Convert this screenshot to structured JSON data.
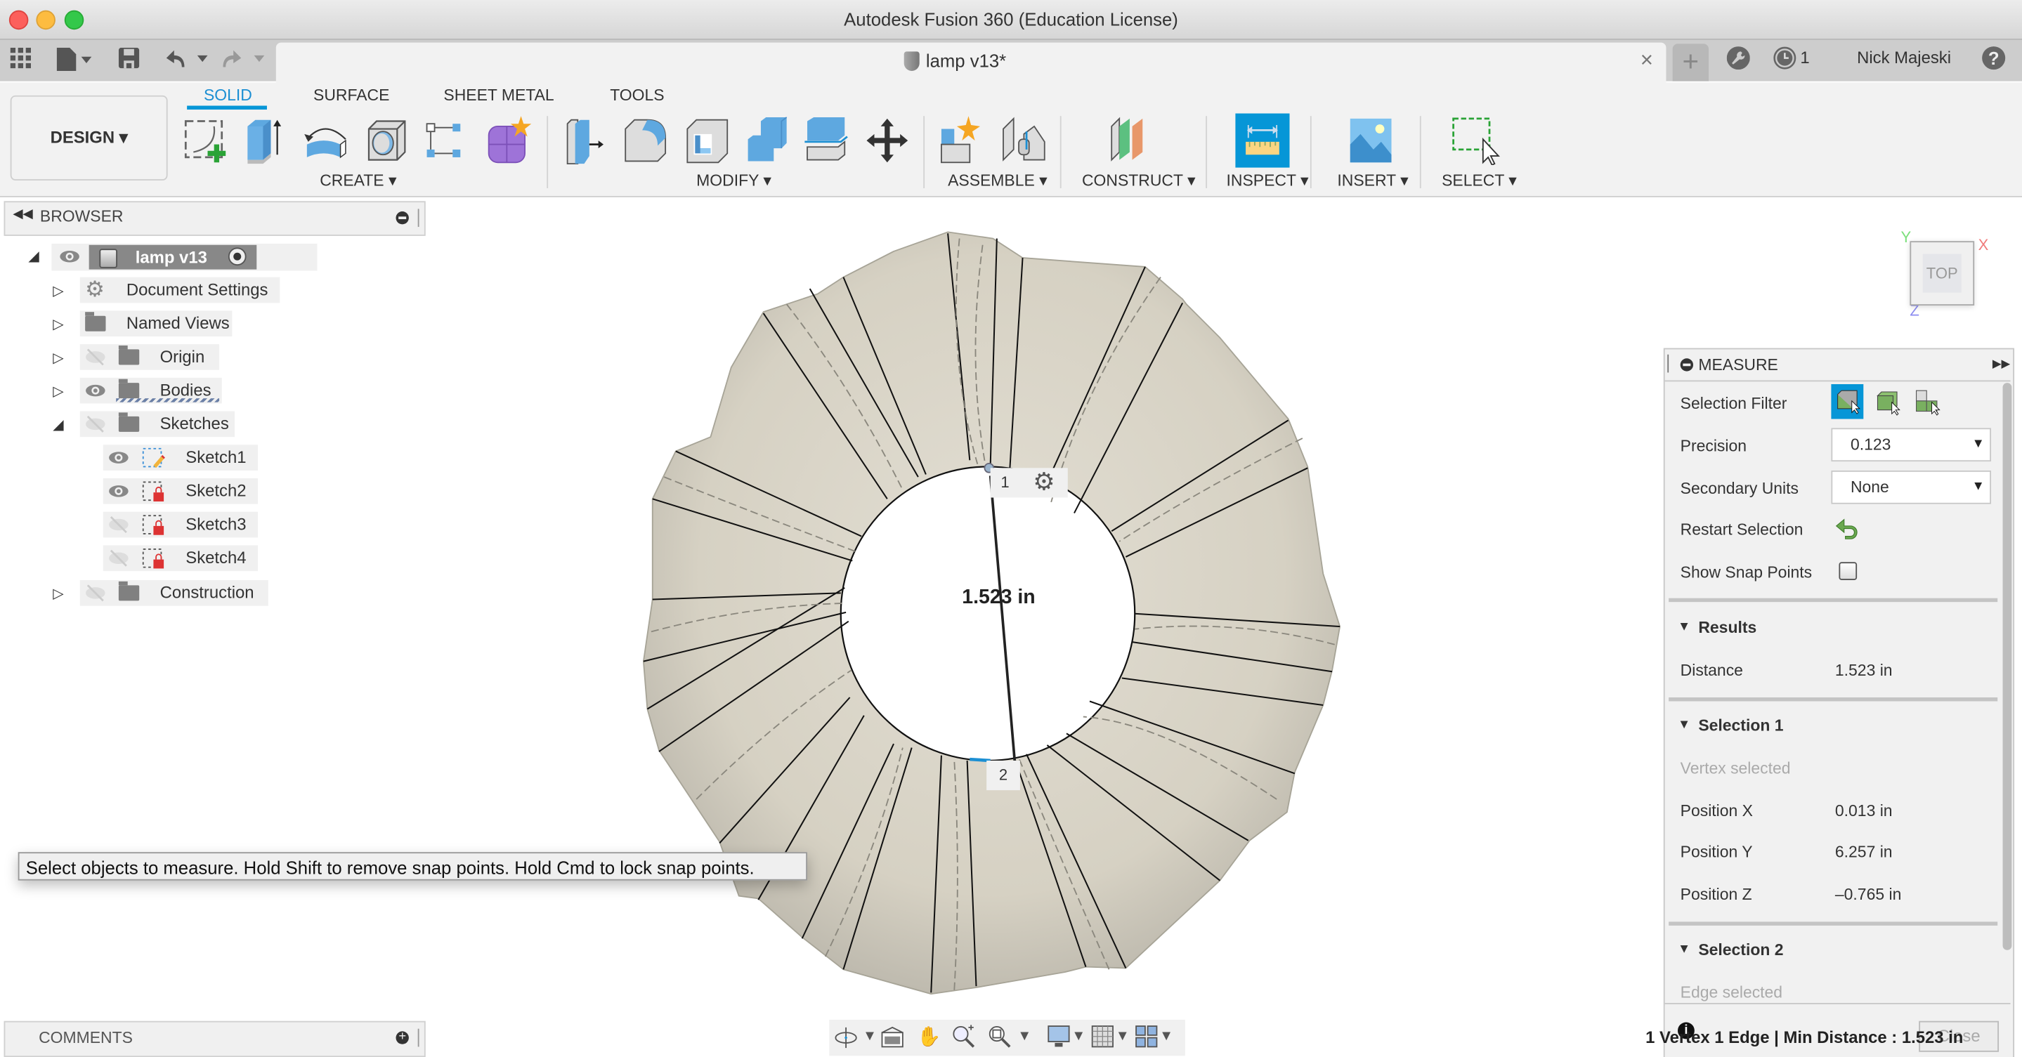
{
  "window": {
    "title": "Autodesk Fusion 360 (Education License)"
  },
  "quick_access": {
    "icons": [
      "data-panel-icon",
      "file-icon",
      "save-icon",
      "undo-icon",
      "redo-icon"
    ]
  },
  "document_tab": {
    "title": "lamp v13*",
    "close_glyph": "×",
    "new_tab_glyph": "+"
  },
  "account": {
    "job_count": "1",
    "user_name": "Nick Majeski",
    "help_glyph": "?"
  },
  "ribbon": {
    "workspace_label": "DESIGN ▾",
    "tabs": [
      {
        "label": "SOLID",
        "active": true
      },
      {
        "label": "SURFACE",
        "active": false
      },
      {
        "label": "SHEET METAL",
        "active": false
      },
      {
        "label": "TOOLS",
        "active": false
      }
    ],
    "groups": [
      {
        "label": "CREATE ▾"
      },
      {
        "label": "MODIFY ▾"
      },
      {
        "label": "ASSEMBLE ▾"
      },
      {
        "label": "CONSTRUCT ▾"
      },
      {
        "label": "INSPECT ▾"
      },
      {
        "label": "INSERT ▾"
      },
      {
        "label": "SELECT ▾"
      }
    ],
    "accent_color": "#0696d7"
  },
  "browser": {
    "title": "BROWSER",
    "root": {
      "label": "lamp v13"
    },
    "items": [
      {
        "label": "Document Settings"
      },
      {
        "label": "Named Views"
      },
      {
        "label": "Origin"
      },
      {
        "label": "Bodies"
      },
      {
        "label": "Sketches"
      },
      {
        "label": "Sketch1"
      },
      {
        "label": "Sketch2"
      },
      {
        "label": "Sketch3"
      },
      {
        "label": "Sketch4"
      },
      {
        "label": "Construction"
      }
    ]
  },
  "viewport": {
    "dimension_label": "1.523 in",
    "point1_label": "1",
    "point2_label": "2",
    "viewcube": {
      "face": "TOP",
      "x": "X",
      "y": "Y",
      "z": "Z"
    },
    "tooltip": "Select objects to measure. Hold Shift to remove snap points. Hold Cmd to lock snap points."
  },
  "comments": {
    "title": "COMMENTS"
  },
  "measure": {
    "title": "MEASURE",
    "selection_filter_label": "Selection Filter",
    "precision_label": "Precision",
    "precision_value": "0.123",
    "secondary_units_label": "Secondary Units",
    "secondary_units_value": "None",
    "restart_selection_label": "Restart Selection",
    "show_snap_points_label": "Show Snap Points",
    "show_snap_points_checked": false,
    "results_title": "Results",
    "distance_label": "Distance",
    "distance_value": "1.523 in",
    "selection1_title": "Selection 1",
    "selection1_type": "Vertex selected",
    "position_x_label": "Position X",
    "position_x_value": "0.013 in",
    "position_y_label": "Position Y",
    "position_y_value": "6.257 in",
    "position_z_label": "Position Z",
    "position_z_value": "–0.765 in",
    "selection2_title": "Selection 2",
    "selection2_type": "Edge selected",
    "close_label": "Close"
  },
  "status": {
    "text": "1 Vertex 1 Edge | Min Distance : 1.523 in"
  }
}
